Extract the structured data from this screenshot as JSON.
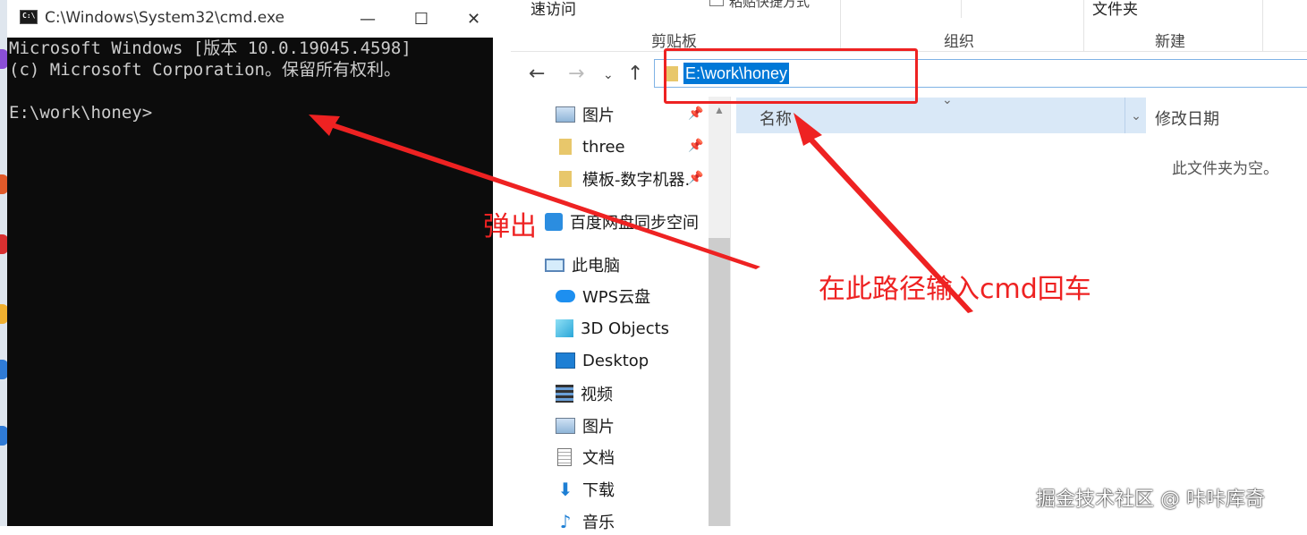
{
  "cmd": {
    "title": "C:\\Windows\\System32\\cmd.exe",
    "lines": [
      "Microsoft Windows [版本 10.0.19045.4598]",
      "(c) Microsoft Corporation。保留所有权利。",
      "",
      "E:\\work\\honey>"
    ],
    "minimize": "—",
    "maximize": "☐",
    "close": "✕"
  },
  "explorer": {
    "ribbon": {
      "quick_access": "速访问",
      "partial_label": "粘贴快捷方式",
      "new_folder": "文件夹",
      "groups": [
        "剪贴板",
        "组织",
        "新建"
      ]
    },
    "address": "E:\\work\\honey",
    "nav_items": [
      {
        "label": "图片",
        "icon": "picture-icon"
      },
      {
        "label": "three",
        "icon": "folder-icon"
      },
      {
        "label": "模板-数字机器.",
        "icon": "folder-icon"
      },
      {
        "label": "百度网盘同步空间",
        "icon": "baidu-cloud-icon"
      },
      {
        "label": "此电脑",
        "icon": "computer-icon"
      },
      {
        "label": "WPS云盘",
        "icon": "cloud-icon"
      },
      {
        "label": "3D Objects",
        "icon": "cube-icon"
      },
      {
        "label": "Desktop",
        "icon": "desktop-icon"
      },
      {
        "label": "视频",
        "icon": "video-icon"
      },
      {
        "label": "图片",
        "icon": "picture-icon"
      },
      {
        "label": "文档",
        "icon": "document-icon"
      },
      {
        "label": "下载",
        "icon": "download-icon"
      },
      {
        "label": "音乐",
        "icon": "music-icon"
      }
    ],
    "columns": {
      "name": "名称",
      "date": "修改日期"
    },
    "empty_message": "此文件夹为空。"
  },
  "annotations": {
    "popup": "弹出",
    "instruction": "在此路径输入cmd回车",
    "color": "#ee2222"
  },
  "watermark": "掘金技术社区 @ 咔咔库奇"
}
